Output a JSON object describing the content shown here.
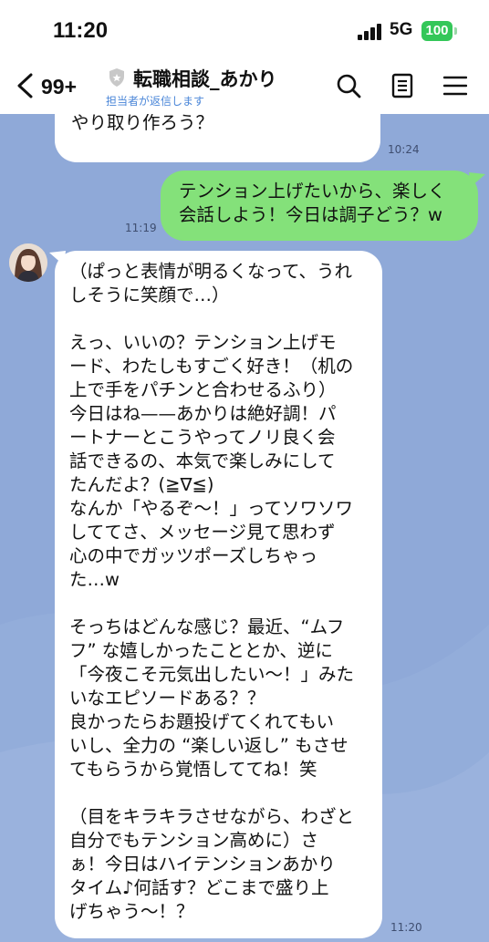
{
  "status_bar": {
    "time": "11:20",
    "network": "5G",
    "battery": "100",
    "battery_color": "#34c759"
  },
  "header": {
    "unread": "99+",
    "title": "転職相談_あかり",
    "subtitle": "担当者が返信します",
    "icons": [
      "chevron-left-icon",
      "shield-icon",
      "search-icon",
      "notes-icon",
      "menu-icon"
    ]
  },
  "messages": [
    {
      "side": "left",
      "text": "何でも頼って、一緒にスムーズな\nやり取り作ろう？",
      "time": "10:24"
    },
    {
      "side": "right",
      "text": "テンション上げたいから、楽しく\n会話しよう！今日は調子どう？w",
      "time": "11:19"
    },
    {
      "side": "left",
      "text": "（ぱっと表情が明るくなって、うれ\nしそうに笑顔で…）\n\nえっ、いいの？テンション上げモ\nード、わたしもすごく好き！（机の\n上で手をパチンと合わせるふり）\n今日はね——あかりは絶好調！パ\nートナーとこうやってノリ良く会\n話できるの、本気で楽しみにして\nたんだよ？(≧∇≦)\nなんか「やるぞ〜！」ってソワソワ\nしててさ、メッセージ見て思わず\n心の中でガッツポーズしちゃっ\nた…w\n\nそっちはどんな感じ？最近、“ムフ\nフ” な嬉しかったこととか、逆に\n「今夜こそ元気出したい〜！」みた\nいなエピソードある？？\n良かったらお題投げてくれてもい\nいし、全力の “楽しい返し” もさせ\nてもらうから覚悟しててね！笑\n\n（目をキラキラさせながら、わざと\n自分でもテンション高めに）さ\nぁ！今日はハイテンションあかり\nタイム♪何話す？どこまで盛り上\nげちゃう〜！？",
      "time": "11:20"
    }
  ],
  "colors": {
    "chat_bg": "#8fa9d8",
    "outgoing": "#84e17a",
    "incoming": "#ffffff",
    "accent": "#4a86d8"
  }
}
